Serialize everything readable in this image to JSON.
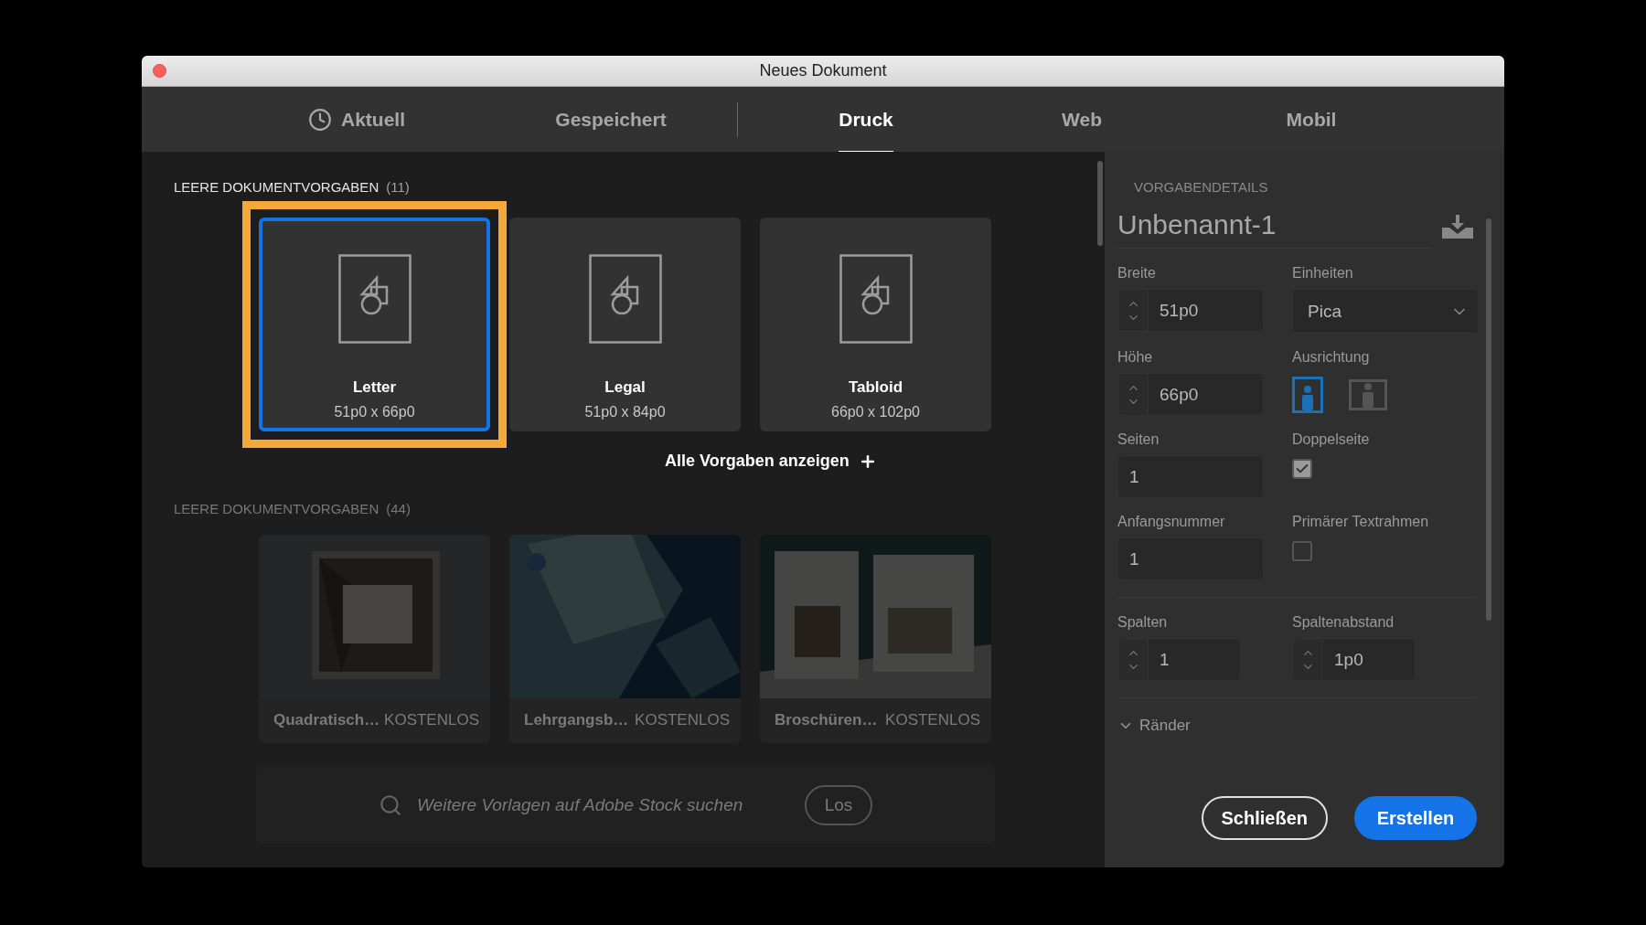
{
  "window": {
    "title": "Neues Dokument"
  },
  "tabs": [
    {
      "label": "Aktuell",
      "kind": "recent",
      "selected": false
    },
    {
      "label": "Gespeichert",
      "kind": "plain",
      "selected": false
    },
    {
      "label": "Druck",
      "kind": "plain",
      "selected": true
    },
    {
      "label": "Web",
      "kind": "plain",
      "selected": false
    },
    {
      "label": "Mobil",
      "kind": "plain",
      "selected": false
    }
  ],
  "blank_presets": {
    "heading": "LEERE DOKUMENTVORGABEN",
    "count": "(11)",
    "cards": [
      {
        "name": "Letter",
        "size": "51p0 x 66p0",
        "selected": true,
        "highlighted": true
      },
      {
        "name": "Legal",
        "size": "51p0 x 84p0",
        "selected": false,
        "highlighted": false
      },
      {
        "name": "Tabloid",
        "size": "66p0 x 102p0",
        "selected": false,
        "highlighted": false
      }
    ],
    "show_all": "Alle Vorgaben anzeigen"
  },
  "templates": {
    "heading": "LEERE DOKUMENTVORGABEN",
    "count": "(44)",
    "dimmed": true,
    "cards": [
      {
        "kind": "picture",
        "name": "Quadratisch…",
        "badge": "KOSTENLOS"
      },
      {
        "kind": "picture",
        "name": "Lehrgangsb…",
        "badge": "KOSTENLOS"
      },
      {
        "kind": "picture",
        "name": "Broschüren…",
        "badge": "KOSTENLOS"
      }
    ],
    "search": {
      "placeholder": "Weitere Vorlagen auf Adobe Stock suchen",
      "button": "Los"
    }
  },
  "details": {
    "heading": "VORGABENDETAILS",
    "name": "Unbenannt-1",
    "groups": [
      [
        [
          {
            "kind": "stepper",
            "label": "Breite",
            "value": "51p0"
          },
          {
            "kind": "select",
            "label": "Einheiten",
            "value": "Pica"
          }
        ],
        [
          {
            "kind": "stepper",
            "label": "Höhe",
            "value": "66p0"
          },
          {
            "kind": "orientation",
            "label": "Ausrichtung",
            "options": [
              {
                "kind": "portrait",
                "selected": true
              },
              {
                "kind": "landscape",
                "selected": false
              }
            ]
          }
        ],
        [
          {
            "kind": "text",
            "label": "Seiten",
            "value": "1"
          },
          {
            "kind": "checkbox",
            "label": "Doppelseite",
            "checked": true
          }
        ],
        [
          {
            "kind": "text",
            "label": "Anfangsnummer",
            "value": "1"
          },
          {
            "kind": "checkbox",
            "label": "Primärer Textrahmen",
            "checked": false
          }
        ]
      ],
      [
        [
          {
            "kind": "stepper",
            "label": "Spalten",
            "value": "1"
          },
          {
            "kind": "stepper",
            "label": "Spaltenabstand",
            "value": "1p0"
          }
        ]
      ]
    ],
    "section": {
      "label": "Ränder",
      "expanded": true
    }
  },
  "buttons": [
    {
      "label": "Schließen",
      "kind": "secondary"
    },
    {
      "label": "Erstellen",
      "kind": "primary"
    }
  ]
}
